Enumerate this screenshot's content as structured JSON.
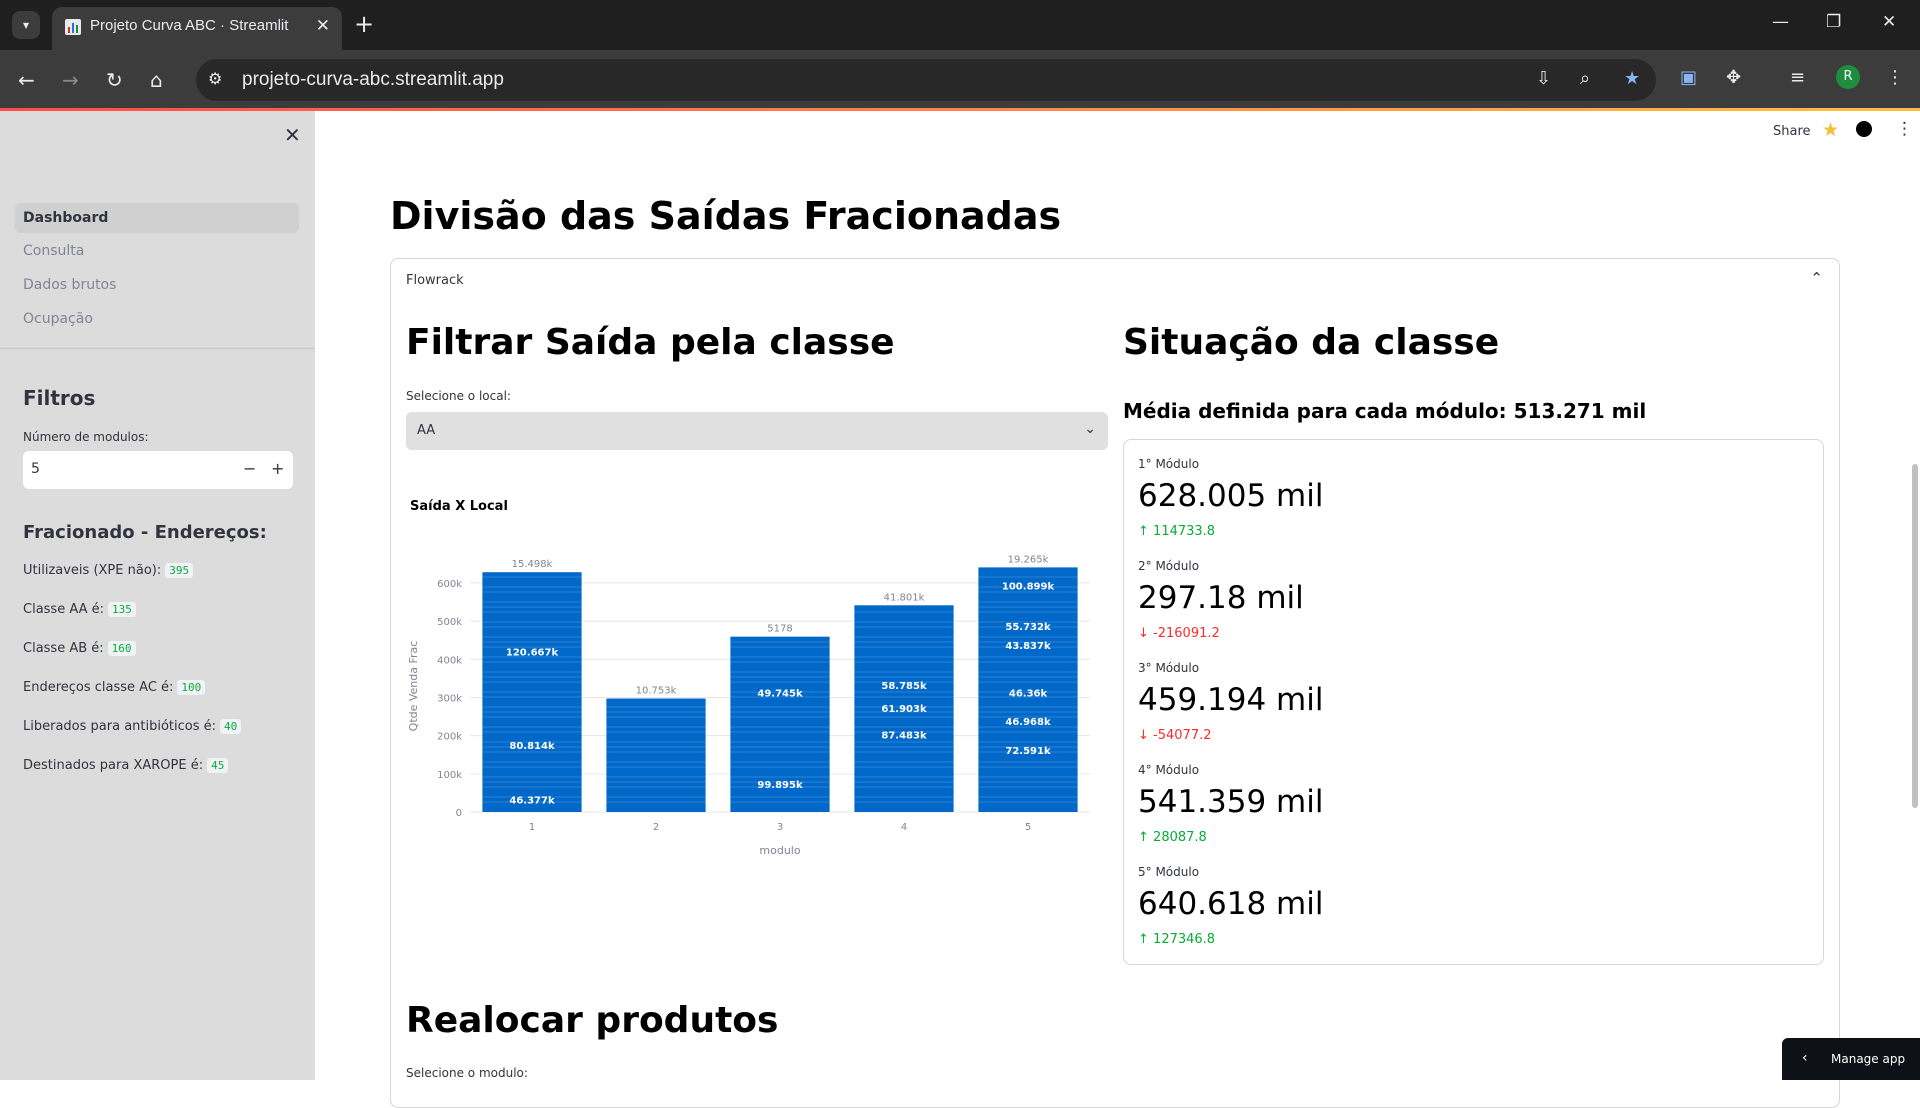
{
  "browser": {
    "tab_title": "Projeto Curva ABC · Streamlit",
    "url": "projeto-curva-abc.streamlit.app",
    "avatar_letter": "R"
  },
  "header": {
    "share_label": "Share"
  },
  "sidebar": {
    "nav": [
      "Dashboard",
      "Consulta",
      "Dados brutos",
      "Ocupação"
    ],
    "filters_title": "Filtros",
    "modules_label": "Número de modulos:",
    "modules_value": "5",
    "addresses_title": "Fracionado - Endereços:",
    "rows": [
      {
        "label": "Utilizaveis (XPE não):",
        "value": "395"
      },
      {
        "label": "Classe AA é:",
        "value": "135"
      },
      {
        "label": "Classe AB é:",
        "value": "160"
      },
      {
        "label": "Endereços classe AC é:",
        "value": "100"
      },
      {
        "label": "Liberados para antibióticos é:",
        "value": "40"
      },
      {
        "label": "Destinados para XAROPE é:",
        "value": "45"
      }
    ]
  },
  "main": {
    "title": "Divisão das Saídas Fracionadas",
    "expander_label": "Flowrack",
    "filter_title": "Filtrar Saída pela classe",
    "select_label": "Selecione o local:",
    "select_value": "AA",
    "chart_title": "Saída X Local",
    "status_title": "Situação da classe",
    "status_subtitle": "Média definida para cada módulo: 513.271 mil",
    "metrics": [
      {
        "label": "1° Módulo",
        "value": "628.005 mil",
        "delta": "114733.8",
        "direction": "up"
      },
      {
        "label": "2° Módulo",
        "value": "297.18 mil",
        "delta": "-216091.2",
        "direction": "down"
      },
      {
        "label": "3° Módulo",
        "value": "459.194 mil",
        "delta": "-54077.2",
        "direction": "down"
      },
      {
        "label": "4° Módulo",
        "value": "541.359 mil",
        "delta": "28087.8",
        "direction": "up"
      },
      {
        "label": "5° Módulo",
        "value": "640.618 mil",
        "delta": "127346.8",
        "direction": "up"
      }
    ],
    "realloc_title": "Realocar produtos",
    "realloc_label": "Selecione o modulo:",
    "manage_app": "Manage app"
  },
  "colors": {
    "bar": "#0068c9",
    "up": "#09ab3b",
    "down": "#ff2b2b",
    "accent": "#ff4b4b"
  },
  "chart_data": {
    "type": "bar",
    "title": "Saída X Local",
    "xlabel": "modulo",
    "ylabel": "Qtde Venda Frac",
    "categories": [
      "1",
      "2",
      "3",
      "4",
      "5"
    ],
    "values": [
      628005,
      297180,
      459194,
      541359,
      640618
    ],
    "top_labels": [
      "15.498k",
      "10.753k",
      "5178",
      "41.801k",
      "19.265k"
    ],
    "y_ticks": [
      0,
      100000,
      200000,
      300000,
      400000,
      500000,
      600000
    ],
    "y_tick_labels": [
      "0",
      "100k",
      "200k",
      "300k",
      "400k",
      "500k",
      "600k"
    ],
    "ylim": [
      0,
      660000
    ],
    "segment_labels": [
      {
        "module": "1",
        "label": "120.667k",
        "value": 420000
      },
      {
        "module": "1",
        "label": "80.814k",
        "value": 175000
      },
      {
        "module": "1",
        "label": "46.377k",
        "value": 33000
      },
      {
        "module": "3",
        "label": "49.745k",
        "value": 313000
      },
      {
        "module": "3",
        "label": "99.895k",
        "value": 73000
      },
      {
        "module": "4",
        "label": "58.785k",
        "value": 333000
      },
      {
        "module": "4",
        "label": "61.903k",
        "value": 273000
      },
      {
        "module": "4",
        "label": "87.483k",
        "value": 203000
      },
      {
        "module": "5",
        "label": "100.899k",
        "value": 593000
      },
      {
        "module": "5",
        "label": "55.732k",
        "value": 487000
      },
      {
        "module": "5",
        "label": "43.837k",
        "value": 437000
      },
      {
        "module": "5",
        "label": "46.36k",
        "value": 313000
      },
      {
        "module": "5",
        "label": "46.968k",
        "value": 238000
      },
      {
        "module": "5",
        "label": "72.591k",
        "value": 163000
      }
    ]
  }
}
